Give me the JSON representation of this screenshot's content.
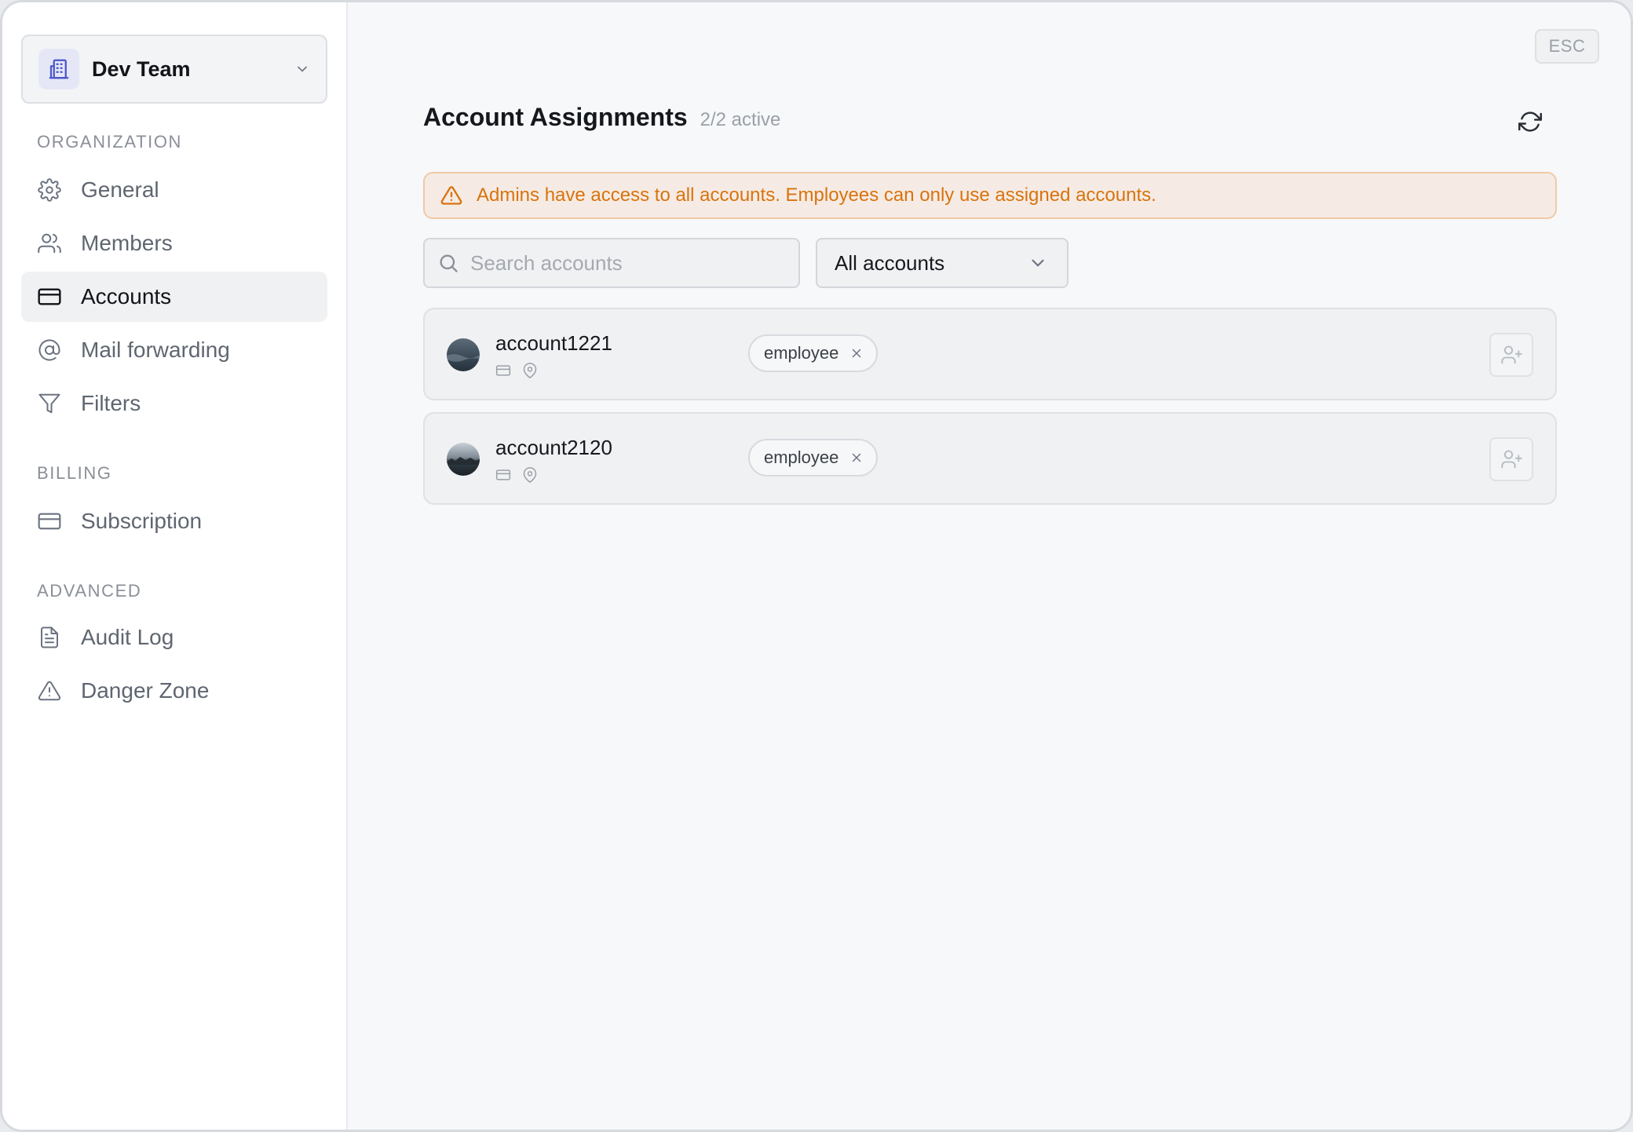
{
  "team": {
    "name": "Dev Team"
  },
  "sidebar": {
    "sections": [
      {
        "label": "ORGANIZATION",
        "items": [
          {
            "label": "General",
            "icon": "gear-icon"
          },
          {
            "label": "Members",
            "icon": "users-icon"
          },
          {
            "label": "Accounts",
            "icon": "credit-card-icon",
            "active": true
          },
          {
            "label": "Mail forwarding",
            "icon": "at-sign-icon"
          },
          {
            "label": "Filters",
            "icon": "filter-icon"
          }
        ]
      },
      {
        "label": "BILLING",
        "items": [
          {
            "label": "Subscription",
            "icon": "credit-card-icon"
          }
        ]
      },
      {
        "label": "ADVANCED",
        "items": [
          {
            "label": "Audit Log",
            "icon": "file-text-icon"
          },
          {
            "label": "Danger Zone",
            "icon": "warning-icon"
          }
        ]
      }
    ]
  },
  "esc_label": "ESC",
  "header": {
    "title": "Account Assignments",
    "subtitle": "2/2 active"
  },
  "alert": {
    "text": "Admins have access to all accounts. Employees can only use assigned accounts.",
    "color": "#d9730d"
  },
  "search": {
    "placeholder": "Search accounts",
    "value": ""
  },
  "filter": {
    "selected": "All accounts"
  },
  "accounts": [
    {
      "name": "account1221",
      "role": "employee"
    },
    {
      "name": "account2120",
      "role": "employee"
    }
  ]
}
